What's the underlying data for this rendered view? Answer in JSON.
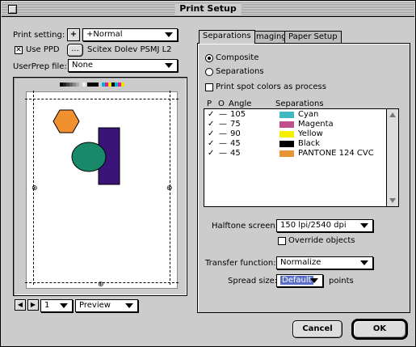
{
  "window": {
    "title": "Print Setup"
  },
  "left": {
    "print_setting_label": "Print setting:",
    "print_setting_value": "+Normal",
    "add_button": "+",
    "use_ppd_label": "Use PPD",
    "use_ppd_checked": true,
    "ppd_button": "...",
    "ppd_name": "Scitex Dolev PSMJ L2",
    "userprep_label": "UserPrep file:",
    "userprep_value": "None",
    "page_value": "1",
    "view_value": "Preview"
  },
  "tabs": [
    "Separations",
    "Imaging",
    "Paper Setup"
  ],
  "active_tab": "Separations",
  "separations": {
    "composite_label": "Composite",
    "separations_label": "Separations",
    "mode": "Composite",
    "spot_label": "Print spot colors as process",
    "spot_checked": false,
    "headers": {
      "p": "P",
      "o": "O",
      "angle": "Angle",
      "sep": "Separations"
    },
    "rows": [
      {
        "p": "✓",
        "o": "—",
        "angle": "105",
        "name": "Cyan",
        "color": "#3fb8c0"
      },
      {
        "p": "✓",
        "o": "—",
        "angle": "75",
        "name": "Magenta",
        "color": "#c0508c"
      },
      {
        "p": "✓",
        "o": "—",
        "angle": "90",
        "name": "Yellow",
        "color": "#f4f000"
      },
      {
        "p": "✓",
        "o": "—",
        "angle": "45",
        "name": "Black",
        "color": "#000000"
      },
      {
        "p": "✓",
        "o": "—",
        "angle": "45",
        "name": "PANTONE 124 CVC",
        "color": "#e8923a"
      }
    ],
    "halftone_label": "Halftone screen:",
    "halftone_value": "150 lpi/2540 dpi",
    "override_label": "Override objects",
    "override_checked": false,
    "transfer_label": "Transfer function:",
    "transfer_value": "Normalize",
    "spread_label": "Spread size:",
    "spread_value": "Default",
    "spread_unit": "points"
  },
  "buttons": {
    "cancel": "Cancel",
    "ok": "OK"
  },
  "colors": {
    "hexagon": "#f0902e",
    "circle": "#188a6a",
    "rect": "#3a1478"
  }
}
